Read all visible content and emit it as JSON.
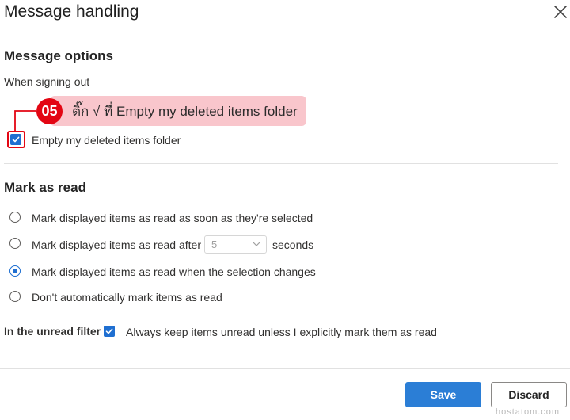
{
  "dialog": {
    "title": "Message handling",
    "close_icon": "close-icon"
  },
  "message_options": {
    "heading": "Message options",
    "signing_out_label": "When signing out",
    "empty_deleted": {
      "label": "Empty my deleted items folder",
      "checked": true
    }
  },
  "annotation": {
    "step": "05",
    "text": "ติ๊ก √ ที่ Empty my deleted items folder",
    "color": "#e30613"
  },
  "mark_as_read": {
    "heading": "Mark as read",
    "options": [
      {
        "label": "Mark displayed items as read as soon as they're selected",
        "checked": false
      },
      {
        "label_before": "Mark displayed items as read after",
        "select_value": "5",
        "label_after": "seconds",
        "checked": false
      },
      {
        "label": "Mark displayed items as read when the selection changes",
        "checked": true
      },
      {
        "label": "Don't automatically mark items as read",
        "checked": false
      }
    ],
    "unread_filter": {
      "label": "In the unread filter",
      "checkbox_label": "Always keep items unread unless I explicitly mark them as read",
      "checked": true
    }
  },
  "footer": {
    "save_label": "Save",
    "discard_label": "Discard"
  },
  "watermark": "hostatom.com",
  "colors": {
    "accent": "#1f6fd1",
    "primary_button": "#2b7ed6",
    "callout_bg": "#f9c6cc"
  }
}
